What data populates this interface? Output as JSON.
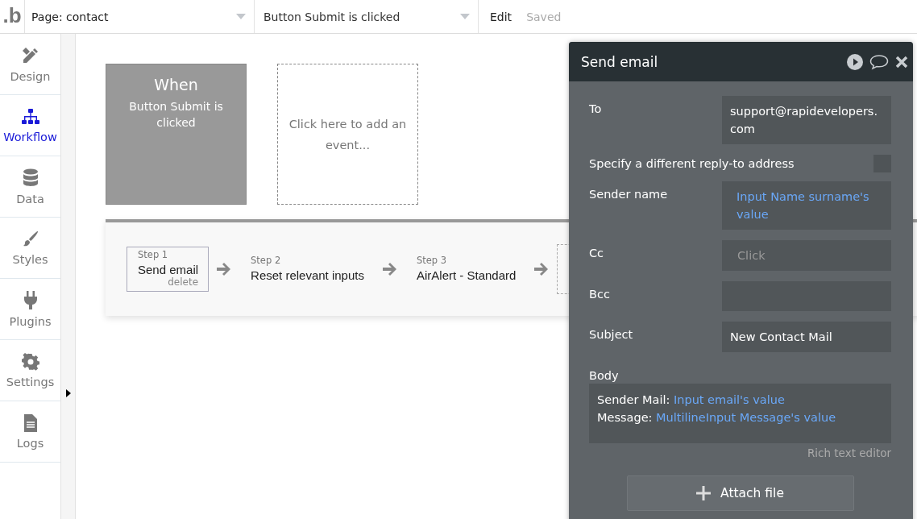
{
  "topbar": {
    "logo": ".b",
    "page_select": "Page: contact",
    "event_select": "Button Submit is clicked",
    "edit": "Edit",
    "status": "Saved"
  },
  "sidebar": {
    "items": [
      {
        "label": "Design",
        "kind": "design",
        "selected": false
      },
      {
        "label": "Workflow",
        "kind": "workflow",
        "selected": true
      },
      {
        "label": "Data",
        "kind": "data",
        "selected": false
      },
      {
        "label": "Styles",
        "kind": "styles",
        "selected": false
      },
      {
        "label": "Plugins",
        "kind": "plugins",
        "selected": false
      },
      {
        "label": "Settings",
        "kind": "settings",
        "selected": false
      },
      {
        "label": "Logs",
        "kind": "logs",
        "selected": false
      }
    ]
  },
  "canvas": {
    "trigger": {
      "title": "When",
      "text": "Button Submit is clicked"
    },
    "add_event": "Click here to add an event...",
    "steps": [
      {
        "step": "Step 1",
        "name": "Send email",
        "selected": true,
        "delete": "delete"
      },
      {
        "step": "Step 2",
        "name": "Reset relevant inputs",
        "selected": false
      },
      {
        "step": "Step 3",
        "name": "AirAlert - Standard",
        "selected": false
      }
    ]
  },
  "panel": {
    "title": "Send email",
    "fields": [
      {
        "label": "To",
        "kind": "text",
        "value": "support@rapidevelopers.com"
      },
      {
        "label": "Specify a different reply-to address",
        "kind": "checkbox",
        "checked": false
      },
      {
        "label": "Sender name",
        "kind": "expression",
        "value": "Input Name surname's value"
      },
      {
        "label": "Cc",
        "kind": "placeholder",
        "placeholder": "Click"
      },
      {
        "label": "Bcc",
        "kind": "text"
      },
      {
        "label": "Subject",
        "kind": "text",
        "value": "New Contact Mail"
      }
    ],
    "body": {
      "label": "Body",
      "lines": [
        {
          "text": "Sender Mail:",
          "expression": "Input email's value"
        },
        {
          "text": "Message:",
          "expression": "MultilineInput Message's value"
        }
      ],
      "note": "Rich text editor"
    },
    "attach_button": "Attach file"
  }
}
